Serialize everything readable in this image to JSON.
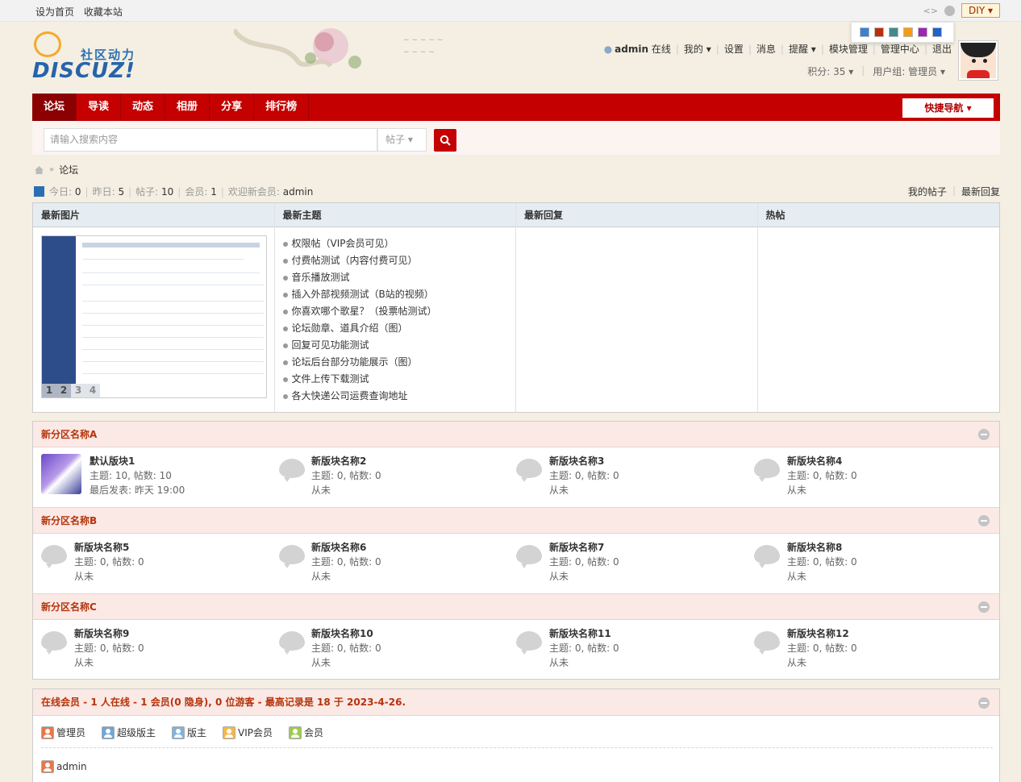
{
  "topbar": {
    "set_home": "设为首页",
    "bookmark": "收藏本站",
    "diy": "DIY",
    "swatches": [
      "#3c7fd1",
      "#b8310c",
      "#438a8d",
      "#f39c12",
      "#9b27b0",
      "#2360c9"
    ]
  },
  "logo": {
    "cn": "社区动力",
    "en": "DISCUZ!"
  },
  "usernav": {
    "username": "admin",
    "status": "在线",
    "items": [
      "我的",
      "设置",
      "消息",
      "提醒",
      "模块管理",
      "管理中心",
      "退出"
    ],
    "points": "积分: 35",
    "group": "用户组: 管理员"
  },
  "nav": {
    "items": [
      "论坛",
      "导读",
      "动态",
      "相册",
      "分享",
      "排行榜"
    ],
    "quick": "快捷导航"
  },
  "search": {
    "placeholder": "请输入搜索内容",
    "type": "帖子"
  },
  "breadcrumb": {
    "current": "论坛"
  },
  "stats": {
    "today_label": "今日:",
    "today": "0",
    "yesterday_label": "昨日:",
    "yesterday": "5",
    "posts_label": "帖子:",
    "posts": "10",
    "members_label": "会员:",
    "members": "1",
    "newmember_label": "欢迎新会员:",
    "newmember": "admin"
  },
  "links": {
    "my_posts": "我的帖子",
    "latest_replies": "最新回复"
  },
  "portal": {
    "cols": [
      "最新图片",
      "最新主题",
      "最新回复",
      "热帖"
    ],
    "slides": [
      "1",
      "2",
      "3",
      "4"
    ],
    "topics": [
      "权限帖（VIP会员可见）",
      "付费帖测试（内容付费可见）",
      "音乐播放测试",
      "插入外部视频测试（B站的视频）",
      "你喜欢哪个歌星？（投票帖测试）",
      "论坛勋章、道具介绍（图）",
      "回复可见功能测试",
      "论坛后台部分功能展示（图）",
      "文件上传下载测试",
      "各大快递公司运费查询地址"
    ]
  },
  "categories": [
    {
      "name": "新分区名称A",
      "boards": [
        {
          "name": "默认版块1",
          "stat": "主题: 10, 帖数: 10",
          "last": "最后发表: 昨天 19:00"
        },
        {
          "name": "新版块名称2",
          "stat": "主题: 0, 帖数: 0",
          "last": "从未"
        },
        {
          "name": "新版块名称3",
          "stat": "主题: 0, 帖数: 0",
          "last": "从未"
        },
        {
          "name": "新版块名称4",
          "stat": "主题: 0, 帖数: 0",
          "last": "从未"
        }
      ]
    },
    {
      "name": "新分区名称B",
      "boards": [
        {
          "name": "新版块名称5",
          "stat": "主题: 0, 帖数: 0",
          "last": "从未"
        },
        {
          "name": "新版块名称6",
          "stat": "主题: 0, 帖数: 0",
          "last": "从未"
        },
        {
          "name": "新版块名称7",
          "stat": "主题: 0, 帖数: 0",
          "last": "从未"
        },
        {
          "name": "新版块名称8",
          "stat": "主题: 0, 帖数: 0",
          "last": "从未"
        }
      ]
    },
    {
      "name": "新分区名称C",
      "boards": [
        {
          "name": "新版块名称9",
          "stat": "主题: 0, 帖数: 0",
          "last": "从未"
        },
        {
          "name": "新版块名称10",
          "stat": "主题: 0, 帖数: 0",
          "last": "从未"
        },
        {
          "name": "新版块名称11",
          "stat": "主题: 0, 帖数: 0",
          "last": "从未"
        },
        {
          "name": "新版块名称12",
          "stat": "主题: 0, 帖数: 0",
          "last": "从未"
        }
      ]
    }
  ],
  "online": {
    "title": "在线会员 - 1 人在线 - 1 会员(0 隐身), 0 位游客 - 最高记录是 18 于 2023-4-26.",
    "legend": [
      {
        "label": "管理员",
        "color": "#e8774a"
      },
      {
        "label": "超级版主",
        "color": "#6fa6d6"
      },
      {
        "label": "版主",
        "color": "#7fb3dd"
      },
      {
        "label": "VIP会员",
        "color": "#f2b84b"
      },
      {
        "label": "会员",
        "color": "#9ccc4f"
      }
    ],
    "member": "admin"
  }
}
